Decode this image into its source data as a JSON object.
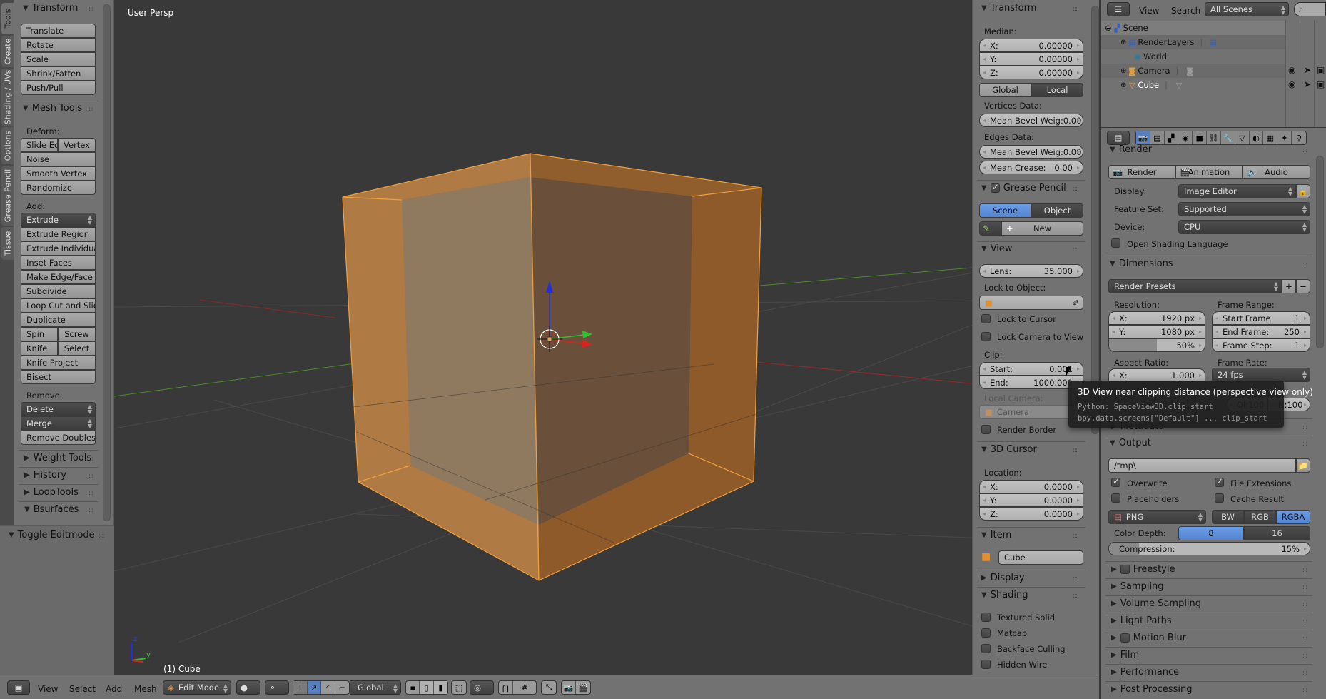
{
  "viewport": {
    "view_label": "User Persp",
    "object_label": "(1) Cube",
    "axis_labels": {
      "z": "z",
      "y": "y"
    },
    "colors": {
      "background": "#393939",
      "selection": "#f0a03c",
      "axis_x": "#c8302c",
      "axis_y": "#4c9a2a",
      "axis_z": "#2040d0"
    }
  },
  "tool_tabs": [
    "Tools",
    "Create",
    "Shading / UVs",
    "Options",
    "Grease Pencil",
    "Tissue"
  ],
  "tool_shelf": {
    "transform": {
      "title": "Transform",
      "buttons": [
        "Translate",
        "Rotate",
        "Scale",
        "Shrink/Fatten",
        "Push/Pull"
      ]
    },
    "mesh_tools": {
      "title": "Mesh Tools",
      "deform_label": "Deform:",
      "slide_edge": "Slide Ed",
      "vertex": "Vertex",
      "noise": "Noise",
      "smooth_vertex": "Smooth Vertex",
      "randomize": "Randomize",
      "add_label": "Add:",
      "extrude": "Extrude",
      "add_buttons": [
        "Extrude Region",
        "Extrude Individual",
        "Inset Faces",
        "Make Edge/Face",
        "Subdivide",
        "Loop Cut and Slide",
        "Duplicate"
      ],
      "spin": "Spin",
      "screw": "Screw",
      "knife": "Knife",
      "select": "Select",
      "knife_project": "Knife Project",
      "bisect": "Bisect",
      "remove_label": "Remove:",
      "delete": "Delete",
      "merge": "Merge",
      "remove_doubles": "Remove Doubles"
    },
    "collapsed_panels": [
      "Weight Tools",
      "History",
      "LoopTools"
    ],
    "bsurfaces": "Bsurfaces",
    "toggle_editmode": "Toggle Editmode"
  },
  "n_panel": {
    "transform": {
      "title": "Transform",
      "median_label": "Median:",
      "x_label": "X:",
      "x_value": "0.00000",
      "y_label": "Y:",
      "y_value": "0.00000",
      "z_label": "Z:",
      "z_value": "0.00000",
      "global": "Global",
      "local": "Local",
      "vertices_data": "Vertices Data:",
      "vert_bevel_label": "Mean Bevel Weig:",
      "vert_bevel_value": "0.00",
      "edges_data": "Edges Data:",
      "edge_bevel_label": "Mean Bevel Weig:",
      "edge_bevel_value": "0.00",
      "crease_label": "Mean Crease:",
      "crease_value": "0.00"
    },
    "grease_pencil": {
      "title": "Grease Pencil",
      "enabled": true,
      "scene": "Scene",
      "object": "Object",
      "new": "New"
    },
    "view": {
      "title": "View",
      "lens_label": "Lens:",
      "lens_value": "35.000",
      "lock_to_object": "Lock to Object:",
      "lock_to_cursor": "Lock to Cursor",
      "lock_camera": "Lock Camera to View",
      "clip_label": "Clip:",
      "start_label": "Start:",
      "start_value": "0.001",
      "end_label": "End:",
      "end_value": "1000.000",
      "local_camera": "Local Camera:",
      "camera": "Camera",
      "render_border": "Render Border"
    },
    "cursor": {
      "title": "3D Cursor",
      "location_label": "Location:",
      "x_label": "X:",
      "x_value": "0.0000",
      "y_label": "Y:",
      "y_value": "0.0000",
      "z_label": "Z:",
      "z_value": "0.0000"
    },
    "item": {
      "title": "Item",
      "name": "Cube"
    },
    "display": {
      "title": "Display"
    },
    "shading": {
      "title": "Shading",
      "options": [
        "Textured Solid",
        "Matcap",
        "Backface Culling",
        "Hidden Wire"
      ]
    }
  },
  "tooltip": {
    "title": "3D View near clipping distance (perspective view only)",
    "python1": "Python: SpaceView3D.clip_start",
    "python2": "bpy.data.screens[\"Default\"] ... clip_start"
  },
  "outliner": {
    "view_menu": "View",
    "search_menu": "Search",
    "scene_filter": "All Scenes",
    "items": [
      {
        "name": "Scene",
        "level": 0
      },
      {
        "name": "RenderLayers",
        "level": 1
      },
      {
        "name": "World",
        "level": 1
      },
      {
        "name": "Camera",
        "level": 1
      },
      {
        "name": "Cube",
        "level": 1
      }
    ]
  },
  "properties": {
    "render": {
      "title": "Render",
      "render_btn": "Render",
      "animation_btn": "Animation",
      "audio_btn": "Audio",
      "display_label": "Display:",
      "display_value": "Image Editor",
      "feature_label": "Feature Set:",
      "feature_value": "Supported",
      "device_label": "Device:",
      "device_value": "CPU",
      "osl": "Open Shading Language"
    },
    "dimensions": {
      "title": "Dimensions",
      "presets": "Render Presets",
      "resolution_label": "Resolution:",
      "res_x_label": "X:",
      "res_x_value": "1920 px",
      "res_y_label": "Y:",
      "res_y_value": "1080 px",
      "res_percent": "50%",
      "res_percent_fraction": 0.5,
      "frame_range_label": "Frame Range:",
      "start_label": "Start Frame:",
      "start_value": "1",
      "end_label": "End Frame:",
      "end_value": "250",
      "step_label": "Frame Step:",
      "step_value": "1",
      "aspect_label": "Aspect Ratio:",
      "aspect_x_label": "X:",
      "aspect_x_value": "1.000",
      "frame_rate_label": "Frame Rate:",
      "frame_rate_value": "24 fps",
      "old_label": "Ol:",
      "old_value": "100",
      "new_label": "N:",
      "new_value": "100"
    },
    "metadata": {
      "title": "Metadata"
    },
    "output": {
      "title": "Output",
      "path": "/tmp\\",
      "overwrite": "Overwrite",
      "file_extensions": "File Extensions",
      "placeholders": "Placeholders",
      "cache_result": "Cache Result",
      "format": "PNG",
      "bw": "BW",
      "rgb": "RGB",
      "rgba": "RGBA",
      "color_depth_label": "Color Depth:",
      "depth_8": "8",
      "depth_16": "16",
      "compression_label": "Compression:",
      "compression_value": "15%",
      "compression_fraction": 0.15
    },
    "collapsed": [
      "Freestyle",
      "Sampling",
      "Volume Sampling",
      "Light Paths",
      "Motion Blur",
      "Film",
      "Performance",
      "Post Processing"
    ]
  },
  "header": {
    "menus": [
      "View",
      "Select",
      "Add",
      "Mesh"
    ],
    "mode": "Edit Mode",
    "orientation": "Global"
  },
  "accent_color": "#5680c2"
}
